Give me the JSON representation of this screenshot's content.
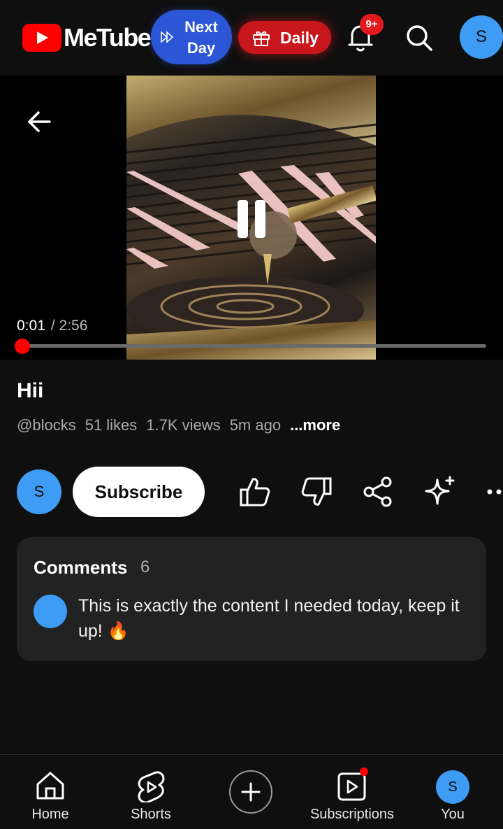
{
  "header": {
    "brand": "MeTube",
    "next_day_label": "Next Day",
    "daily_label": "Daily",
    "notification_badge": "9+",
    "profile_initial": "S"
  },
  "player": {
    "current_time": "0:01",
    "total_time": "/ 2:56",
    "progress_fraction": 0.006
  },
  "video": {
    "title": "Hii",
    "channel": "@blocks",
    "likes": "51 likes",
    "views": "1.7K views",
    "age": "5m ago",
    "more": "...more"
  },
  "actions": {
    "channel_initial": "S",
    "subscribe_label": "Subscribe"
  },
  "comments": {
    "heading": "Comments",
    "count": "6",
    "top_comment": "This is exactly the content I needed today, keep it up! 🔥"
  },
  "nav": {
    "home": "Home",
    "shorts": "Shorts",
    "subscriptions": "Subscriptions",
    "you": "You",
    "you_initial": "S"
  },
  "colors": {
    "brand_red": "#ff0000",
    "next_day_blue": "#2b56d6",
    "avatar_blue": "#3f9cf5",
    "background": "#0f0f0f"
  }
}
